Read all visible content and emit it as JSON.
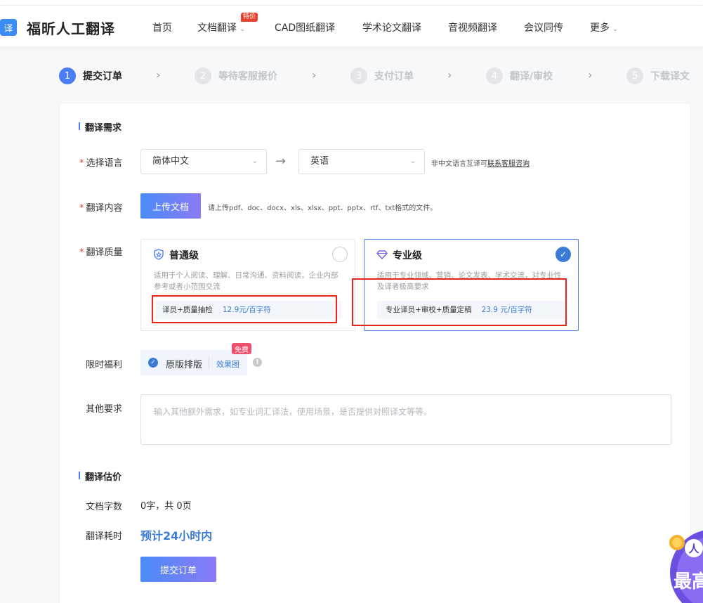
{
  "brand": {
    "logo_char": "译",
    "name": "福昕人工翻译"
  },
  "nav": {
    "items": [
      "首页",
      "文档翻译",
      "CAD图纸翻译",
      "学术论文翻译",
      "音视频翻译",
      "会议同传",
      "更多"
    ],
    "special_badge": "特价",
    "chevron": "⌄"
  },
  "steps": [
    {
      "num": "1",
      "label": "提交订单",
      "state": "active"
    },
    {
      "num": "2",
      "label": "等待客服报价",
      "state": "inactive"
    },
    {
      "num": "3",
      "label": "支付订单",
      "state": "inactive"
    },
    {
      "num": "4",
      "label": "翻译/审校",
      "state": "inactive"
    },
    {
      "num": "5",
      "label": "下载译文",
      "state": "inactive"
    }
  ],
  "step_arrow": "›",
  "requirements": {
    "section_title": "翻译需求",
    "required_mark": "*",
    "language_label": "选择语言",
    "source_lang": "简体中文",
    "target_lang": "英语",
    "swap_arrow": "→",
    "lang_hint_prefix": "非中文语言互译可",
    "lang_hint_link": "联系客服咨询",
    "content_label": "翻译内容",
    "upload_button": "上传文档",
    "upload_hint": "请上传pdf、doc、docx、xls、xlsx、ppt、pptx、rtf、txt格式的文件。",
    "quality_label": "翻译质量",
    "quality_options": [
      {
        "title": "普通级",
        "desc": "适用于个人阅读、理解、日常沟通、资料阅读，企业内部参考或者小范围交流",
        "service": "译员+质量抽检",
        "price": "12.9元/百字符",
        "selected": false
      },
      {
        "title": "专业级",
        "desc": "适用于专业领域、营销、论文发表、学术交流，对专业性及译者极高要求",
        "service": "专业译员+审校+质量定稿",
        "price": "23.9 元/百字符",
        "selected": true
      }
    ],
    "benefit_label": "限时福利",
    "benefit_option": "原版排版",
    "benefit_link": "效果图",
    "free_tag": "免费",
    "info_mark": "!",
    "other_label": "其他要求",
    "other_placeholder": "输入其他额外需求，如专业词汇译法，使用场景，是否提供对照译文等等。"
  },
  "estimate": {
    "section_title": "翻译估价",
    "count_label": "文档字数",
    "count_value": "0字，共 0页",
    "time_label": "翻译耗时",
    "time_value": "预计24小时内",
    "submit_button": "提交订单"
  },
  "promo": {
    "text1": "人",
    "text2": "最高"
  },
  "colors": {
    "accent": "#3a7bd5",
    "annotation_red": "#e8241f",
    "required": "#e8412c"
  }
}
